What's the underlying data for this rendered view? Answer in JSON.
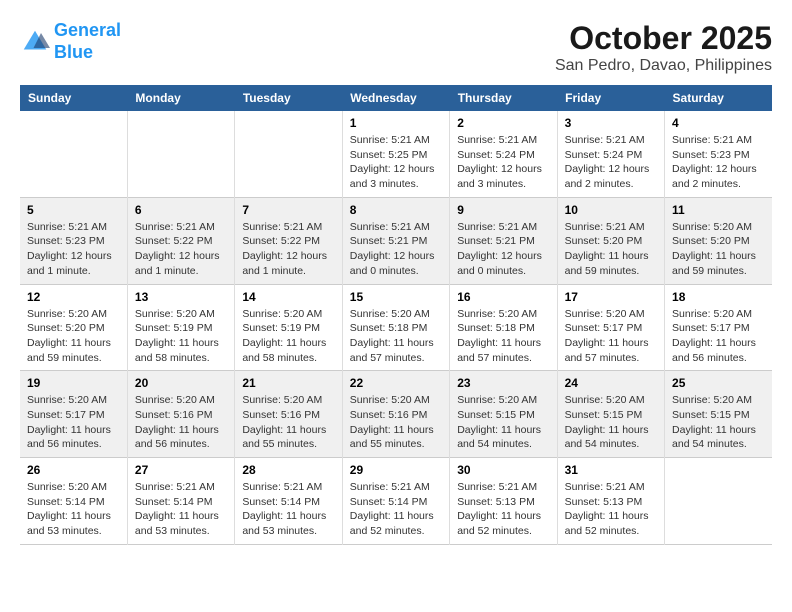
{
  "header": {
    "logo_line1": "General",
    "logo_line2": "Blue",
    "title": "October 2025",
    "subtitle": "San Pedro, Davao, Philippines"
  },
  "calendar": {
    "days_of_week": [
      "Sunday",
      "Monday",
      "Tuesday",
      "Wednesday",
      "Thursday",
      "Friday",
      "Saturday"
    ],
    "rows": [
      [
        {
          "day": "",
          "info": ""
        },
        {
          "day": "",
          "info": ""
        },
        {
          "day": "",
          "info": ""
        },
        {
          "day": "1",
          "info": "Sunrise: 5:21 AM\nSunset: 5:25 PM\nDaylight: 12 hours and 3 minutes."
        },
        {
          "day": "2",
          "info": "Sunrise: 5:21 AM\nSunset: 5:24 PM\nDaylight: 12 hours and 3 minutes."
        },
        {
          "day": "3",
          "info": "Sunrise: 5:21 AM\nSunset: 5:24 PM\nDaylight: 12 hours and 2 minutes."
        },
        {
          "day": "4",
          "info": "Sunrise: 5:21 AM\nSunset: 5:23 PM\nDaylight: 12 hours and 2 minutes."
        }
      ],
      [
        {
          "day": "5",
          "info": "Sunrise: 5:21 AM\nSunset: 5:23 PM\nDaylight: 12 hours and 1 minute."
        },
        {
          "day": "6",
          "info": "Sunrise: 5:21 AM\nSunset: 5:22 PM\nDaylight: 12 hours and 1 minute."
        },
        {
          "day": "7",
          "info": "Sunrise: 5:21 AM\nSunset: 5:22 PM\nDaylight: 12 hours and 1 minute."
        },
        {
          "day": "8",
          "info": "Sunrise: 5:21 AM\nSunset: 5:21 PM\nDaylight: 12 hours and 0 minutes."
        },
        {
          "day": "9",
          "info": "Sunrise: 5:21 AM\nSunset: 5:21 PM\nDaylight: 12 hours and 0 minutes."
        },
        {
          "day": "10",
          "info": "Sunrise: 5:21 AM\nSunset: 5:20 PM\nDaylight: 11 hours and 59 minutes."
        },
        {
          "day": "11",
          "info": "Sunrise: 5:20 AM\nSunset: 5:20 PM\nDaylight: 11 hours and 59 minutes."
        }
      ],
      [
        {
          "day": "12",
          "info": "Sunrise: 5:20 AM\nSunset: 5:20 PM\nDaylight: 11 hours and 59 minutes."
        },
        {
          "day": "13",
          "info": "Sunrise: 5:20 AM\nSunset: 5:19 PM\nDaylight: 11 hours and 58 minutes."
        },
        {
          "day": "14",
          "info": "Sunrise: 5:20 AM\nSunset: 5:19 PM\nDaylight: 11 hours and 58 minutes."
        },
        {
          "day": "15",
          "info": "Sunrise: 5:20 AM\nSunset: 5:18 PM\nDaylight: 11 hours and 57 minutes."
        },
        {
          "day": "16",
          "info": "Sunrise: 5:20 AM\nSunset: 5:18 PM\nDaylight: 11 hours and 57 minutes."
        },
        {
          "day": "17",
          "info": "Sunrise: 5:20 AM\nSunset: 5:17 PM\nDaylight: 11 hours and 57 minutes."
        },
        {
          "day": "18",
          "info": "Sunrise: 5:20 AM\nSunset: 5:17 PM\nDaylight: 11 hours and 56 minutes."
        }
      ],
      [
        {
          "day": "19",
          "info": "Sunrise: 5:20 AM\nSunset: 5:17 PM\nDaylight: 11 hours and 56 minutes."
        },
        {
          "day": "20",
          "info": "Sunrise: 5:20 AM\nSunset: 5:16 PM\nDaylight: 11 hours and 56 minutes."
        },
        {
          "day": "21",
          "info": "Sunrise: 5:20 AM\nSunset: 5:16 PM\nDaylight: 11 hours and 55 minutes."
        },
        {
          "day": "22",
          "info": "Sunrise: 5:20 AM\nSunset: 5:16 PM\nDaylight: 11 hours and 55 minutes."
        },
        {
          "day": "23",
          "info": "Sunrise: 5:20 AM\nSunset: 5:15 PM\nDaylight: 11 hours and 54 minutes."
        },
        {
          "day": "24",
          "info": "Sunrise: 5:20 AM\nSunset: 5:15 PM\nDaylight: 11 hours and 54 minutes."
        },
        {
          "day": "25",
          "info": "Sunrise: 5:20 AM\nSunset: 5:15 PM\nDaylight: 11 hours and 54 minutes."
        }
      ],
      [
        {
          "day": "26",
          "info": "Sunrise: 5:20 AM\nSunset: 5:14 PM\nDaylight: 11 hours and 53 minutes."
        },
        {
          "day": "27",
          "info": "Sunrise: 5:21 AM\nSunset: 5:14 PM\nDaylight: 11 hours and 53 minutes."
        },
        {
          "day": "28",
          "info": "Sunrise: 5:21 AM\nSunset: 5:14 PM\nDaylight: 11 hours and 53 minutes."
        },
        {
          "day": "29",
          "info": "Sunrise: 5:21 AM\nSunset: 5:14 PM\nDaylight: 11 hours and 52 minutes."
        },
        {
          "day": "30",
          "info": "Sunrise: 5:21 AM\nSunset: 5:13 PM\nDaylight: 11 hours and 52 minutes."
        },
        {
          "day": "31",
          "info": "Sunrise: 5:21 AM\nSunset: 5:13 PM\nDaylight: 11 hours and 52 minutes."
        },
        {
          "day": "",
          "info": ""
        }
      ]
    ]
  }
}
